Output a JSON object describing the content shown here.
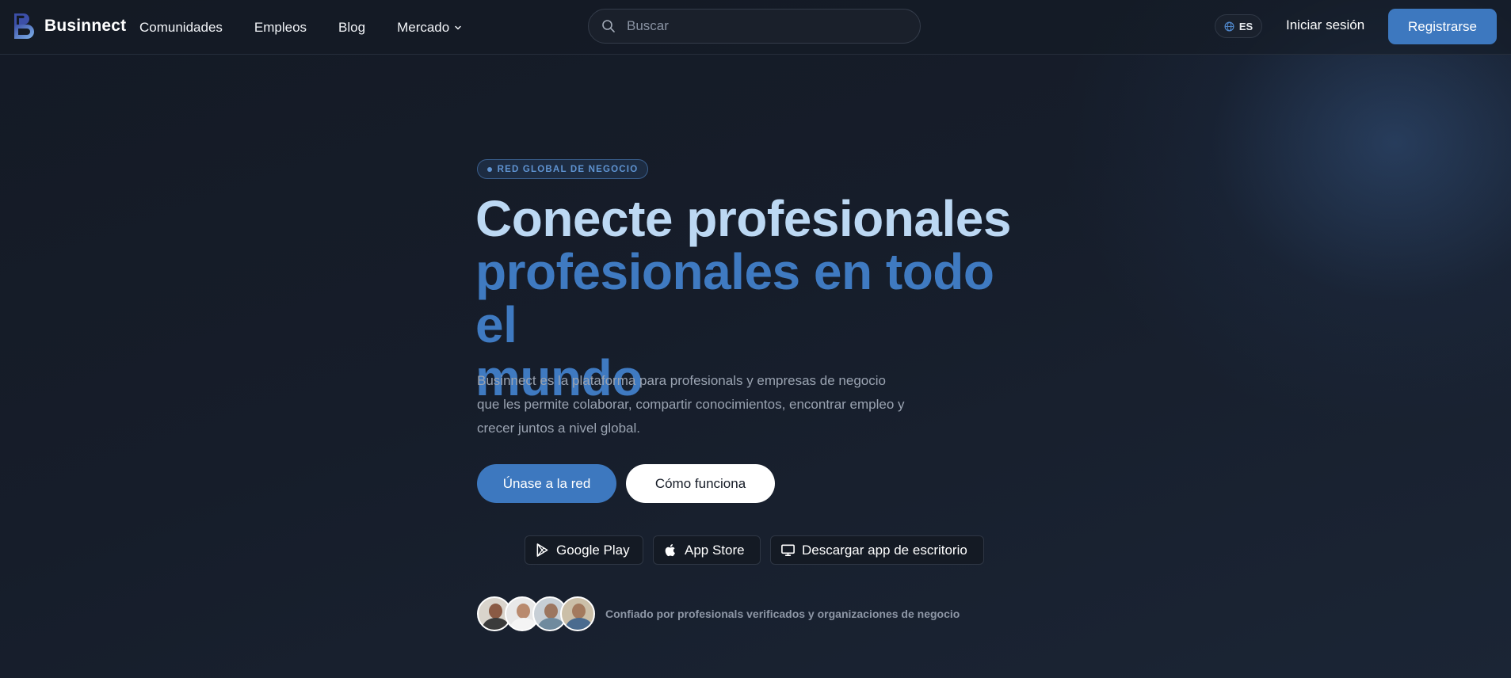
{
  "nav": {
    "brand": "Businnect",
    "links": [
      "Comunidades",
      "Empleos",
      "Blog",
      "Mercado"
    ],
    "search_placeholder": "Buscar",
    "language": "ES",
    "login": "Iniciar sesión",
    "signup": "Registrarse"
  },
  "hero": {
    "badge": "RED GLOBAL DE NEGOCIO",
    "headline_line1": "Conecte profesionales",
    "headline_line2": "profesionales en todo el",
    "headline_line3": "mundo",
    "description": "Businnect es la plataforma para profesionals y empresas de negocio que les permite colaborar, compartir conocimientos, encontrar empleo y crecer juntos a nivel global.",
    "primary_button": "Únase a la red",
    "secondary_button": "Cómo funciona",
    "stores": [
      {
        "label": "Google Play",
        "icon": "google-play-icon"
      },
      {
        "label": "App Store",
        "icon": "apple-icon"
      },
      {
        "label": "Descargar app de escritorio",
        "icon": "desktop-icon"
      }
    ],
    "trust_text": "Confiado por profesionals verificados y organizaciones de negocio"
  },
  "colors": {
    "background": "#151b26",
    "accent": "#3d78bf",
    "headline_light": "#bcd8f3",
    "headline_accent": "#3f7ac1"
  }
}
